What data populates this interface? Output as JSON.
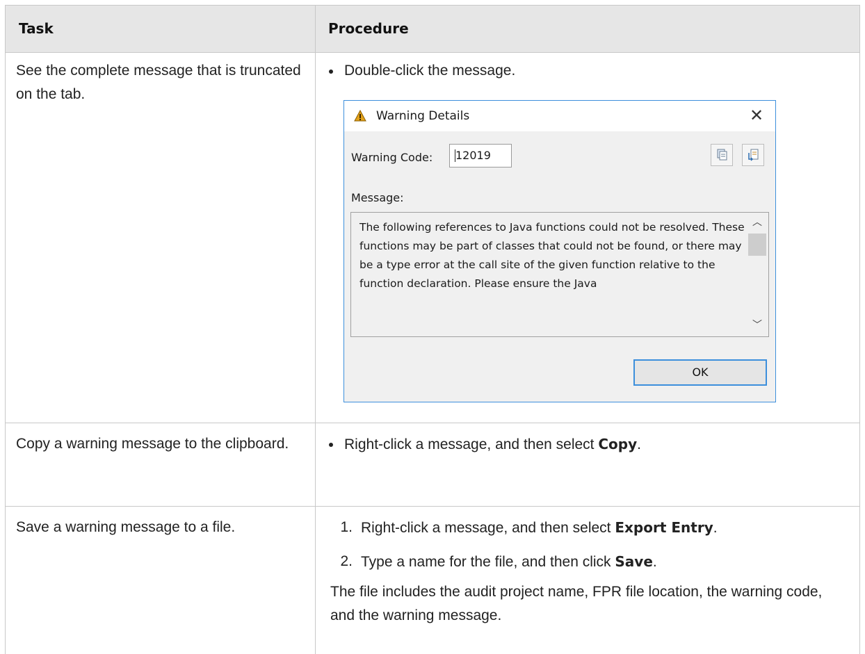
{
  "table": {
    "headers": [
      "Task",
      "Procedure"
    ],
    "rows": [
      {
        "task": "See the complete message that is truncated on the tab.",
        "bullet": "Double-click the message."
      },
      {
        "task": "Copy a warning message to the clipboard.",
        "bullet_prefix": "Right-click a message, and then select ",
        "bullet_bold": "Copy",
        "bullet_suffix": "."
      },
      {
        "task": "Save a warning message to a file.",
        "steps": [
          {
            "num": "1.",
            "prefix": "Right-click a message, and then select ",
            "bold": "Export Entry",
            "suffix": "."
          },
          {
            "num": "2.",
            "prefix": "Type a name for the file, and then click ",
            "bold": "Save",
            "suffix": "."
          }
        ],
        "note": "The file includes the audit project name, FPR file location, the warning code, and the warning message."
      }
    ]
  },
  "dialog": {
    "title": "Warning Details",
    "title_icon": "warning-icon",
    "close_icon": "close-icon",
    "code_label": "Warning Code:",
    "code_value": "12019",
    "message_label": "Message:",
    "message_text": "The following references to Java functions could not be resolved. These functions may be part of classes that could not be found, or there may be a type error at the call site of the given function relative to the function declaration. Please ensure the Java",
    "ok_label": "OK",
    "accent": "#3c8fdc"
  }
}
